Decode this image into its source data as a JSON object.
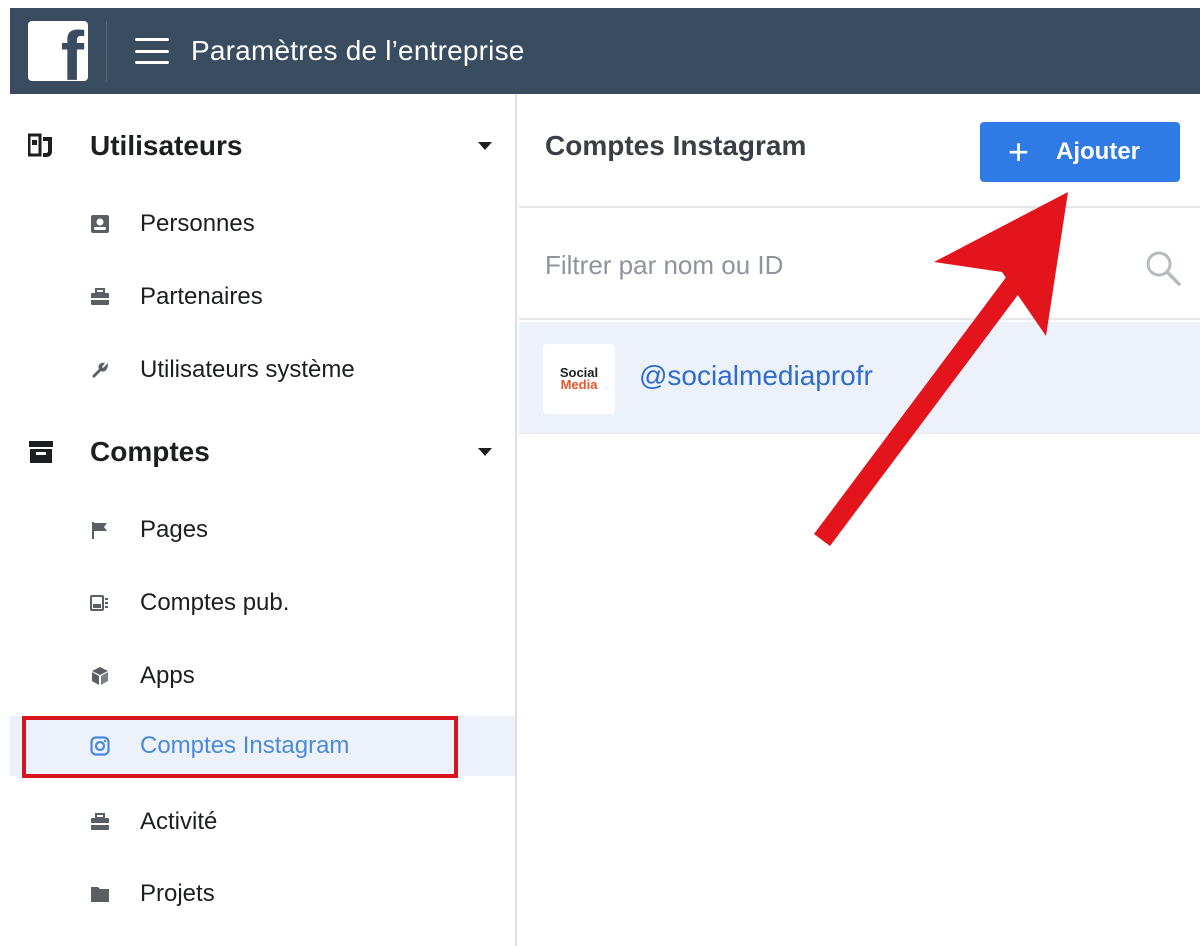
{
  "topbar": {
    "logo_letter": "f",
    "title": "Paramètres de l’entreprise"
  },
  "sidebar": {
    "sections": [
      {
        "label": "Utilisateurs",
        "icon": "users-icon",
        "items": [
          {
            "label": "Personnes",
            "icon": "person-card-icon"
          },
          {
            "label": "Partenaires",
            "icon": "briefcase-icon"
          },
          {
            "label": "Utilisateurs système",
            "icon": "wrench-icon"
          }
        ]
      },
      {
        "label": "Comptes",
        "icon": "archive-box-icon",
        "items": [
          {
            "label": "Pages",
            "icon": "flag-icon"
          },
          {
            "label": "Comptes pub.",
            "icon": "ad-account-icon"
          },
          {
            "label": "Apps",
            "icon": "cube-icon"
          },
          {
            "label": "Comptes Instagram",
            "icon": "instagram-icon",
            "active": true
          },
          {
            "label": "Activité",
            "icon": "briefcase-icon"
          },
          {
            "label": "Projets",
            "icon": "folder-icon"
          }
        ]
      }
    ]
  },
  "main": {
    "title": "Comptes Instagram",
    "add_button": {
      "plus": "+",
      "label": "Ajouter"
    },
    "filter": {
      "placeholder": "Filtrer par nom ou ID",
      "value": ""
    },
    "accounts": [
      {
        "handle": "@socialmediaprofr",
        "avatar_line1": "Social",
        "avatar_line2": "Media"
      }
    ]
  },
  "colors": {
    "topbar": "#3a4c5f",
    "button": "#2f7ae5",
    "active_link": "#4a8ad9",
    "highlight_box": "#d8121e",
    "arrow": "#e3141c"
  }
}
